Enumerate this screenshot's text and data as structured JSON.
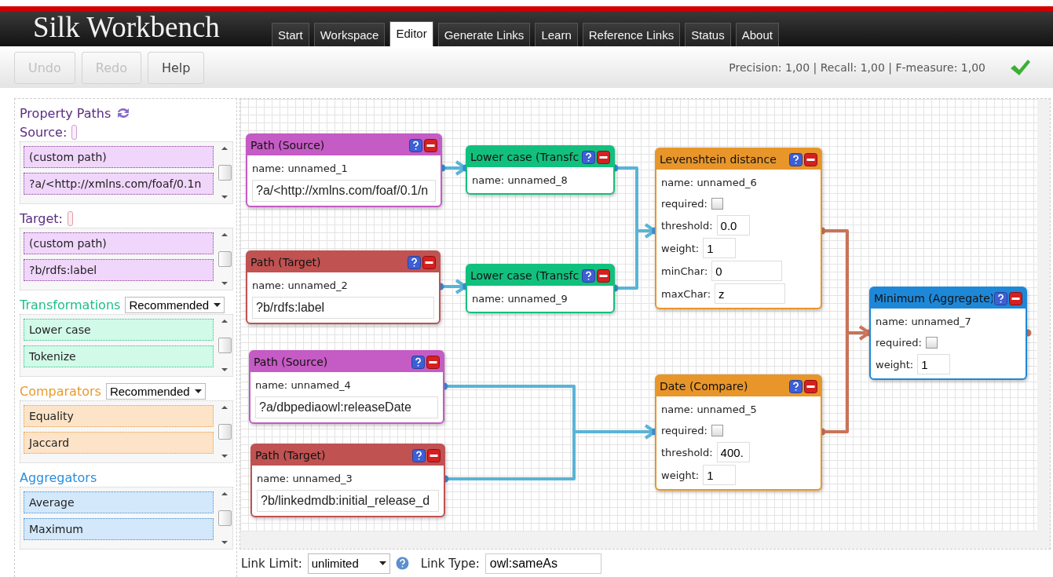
{
  "app": {
    "title": "Silk Workbench"
  },
  "tabs": [
    {
      "label": "Start",
      "selected": false
    },
    {
      "label": "Workspace",
      "selected": false
    },
    {
      "label": "Editor",
      "selected": true
    },
    {
      "label": "Generate Links",
      "selected": false
    },
    {
      "label": "Learn",
      "selected": false
    },
    {
      "label": "Reference Links",
      "selected": false
    },
    {
      "label": "Status",
      "selected": false
    },
    {
      "label": "About",
      "selected": false
    }
  ],
  "toolbar": {
    "buttons": [
      {
        "label": "Undo",
        "disabled": true
      },
      {
        "label": "Redo",
        "disabled": true
      },
      {
        "label": "Help",
        "disabled": false
      }
    ],
    "status": "Precision: 1,00 | Recall: 1,00 | F-measure: 1,00"
  },
  "sidebar": {
    "sections": [
      {
        "kind": "paths",
        "title": "Property Paths",
        "groups": [
          {
            "label": "Source:",
            "items": [
              "(custom path)",
              "?a/<http://xmlns.com/foaf/0.1n"
            ]
          },
          {
            "label": "Target:",
            "items": [
              "(custom path)",
              "?b/rdfs:label"
            ]
          }
        ]
      },
      {
        "kind": "transform",
        "title": "Transformations",
        "filter": "Recommended",
        "items": [
          "Lower case",
          "Tokenize"
        ]
      },
      {
        "kind": "compare",
        "title": "Comparators",
        "filter": "Recommended",
        "items": [
          "Equality",
          "Jaccard"
        ]
      },
      {
        "kind": "aggregate",
        "title": "Aggregators",
        "items": [
          "Average",
          "Maximum"
        ]
      }
    ]
  },
  "canvas": {
    "nodes": [
      {
        "kind": "source",
        "title": "Path (Source)",
        "fields": [
          {
            "kind": "label",
            "text": "name: unnamed_1"
          },
          {
            "kind": "path",
            "value": "?a/<http://xmlns.com/foaf/0.1/n"
          }
        ]
      },
      {
        "kind": "target",
        "title": "Path (Target)",
        "fields": [
          {
            "kind": "label",
            "text": "name: unnamed_2"
          },
          {
            "kind": "path",
            "value": "?b/rdfs:label"
          }
        ]
      },
      {
        "kind": "transform",
        "title": "Lower case (Transfc",
        "fields": [
          {
            "kind": "label",
            "text": "name: unnamed_8"
          }
        ]
      },
      {
        "kind": "transform",
        "title": "Lower case (Transfc",
        "fields": [
          {
            "kind": "label",
            "text": "name: unnamed_9"
          }
        ]
      },
      {
        "kind": "compare",
        "title": "Levenshtein distance",
        "fields": [
          {
            "kind": "label",
            "text": "name: unnamed_6"
          },
          {
            "kind": "checkbox",
            "label": "required:",
            "checked": false
          },
          {
            "kind": "input",
            "label": "threshold:",
            "value": "0.0"
          },
          {
            "kind": "input",
            "label": "weight:",
            "value": "1"
          },
          {
            "kind": "input",
            "label": "minChar:",
            "value": "0",
            "wide": true
          },
          {
            "kind": "input",
            "label": "maxChar:",
            "value": "z",
            "wide": true
          }
        ]
      },
      {
        "kind": "source",
        "title": "Path (Source)",
        "fields": [
          {
            "kind": "label",
            "text": "name: unnamed_4"
          },
          {
            "kind": "path",
            "value": "?a/dbpediaowl:releaseDate"
          }
        ]
      },
      {
        "kind": "target",
        "title": "Path (Target)",
        "fields": [
          {
            "kind": "label",
            "text": "name: unnamed_3"
          },
          {
            "kind": "path",
            "value": "?b/linkedmdb:initial_release_d"
          }
        ]
      },
      {
        "kind": "compare",
        "title": "Date (Compare)",
        "fields": [
          {
            "kind": "label",
            "text": "name: unnamed_5"
          },
          {
            "kind": "checkbox",
            "label": "required:",
            "checked": false
          },
          {
            "kind": "input",
            "label": "threshold:",
            "value": "400."
          },
          {
            "kind": "input",
            "label": "weight:",
            "value": "1"
          }
        ]
      },
      {
        "kind": "aggregate",
        "title": "Minimum (Aggregate)",
        "fields": [
          {
            "kind": "label",
            "text": "name: unnamed_7"
          },
          {
            "kind": "checkbox",
            "label": "required:",
            "checked": false
          },
          {
            "kind": "input",
            "label": "weight:",
            "value": "1"
          }
        ]
      }
    ]
  },
  "footer": {
    "link_limit": {
      "label": "Link Limit:",
      "value": "unlimited"
    },
    "link_type": {
      "label": "Link Type:",
      "value": "owl:sameAs"
    }
  }
}
